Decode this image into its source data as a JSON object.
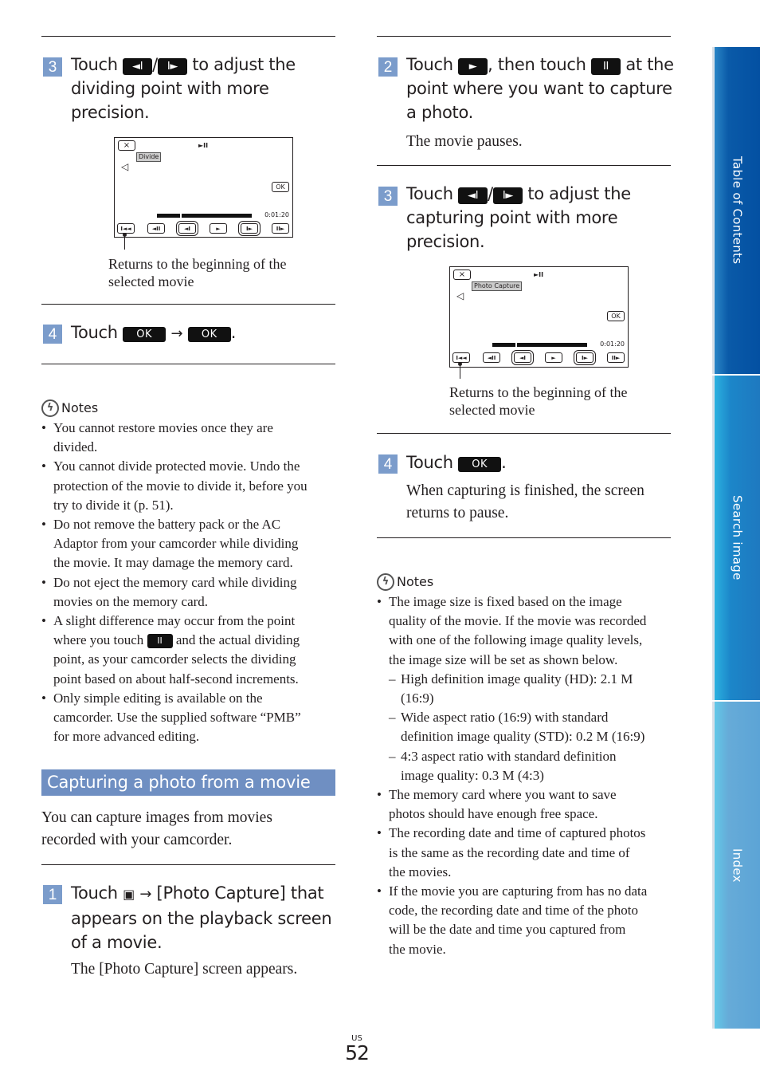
{
  "left": {
    "step3": {
      "number": "3",
      "pre": "Touch ",
      "icon1": "◄I",
      "sep": "/",
      "icon2": "I►",
      "post": " to adjust the",
      "line2": "dividing point with more",
      "line3": "precision."
    },
    "lcd": {
      "close": "×",
      "play_pause": "►II",
      "label": "Divide",
      "speaker": "🔈",
      "ok": "OK",
      "time": "0:01:20",
      "controls": [
        "I◄◄",
        "◄II",
        "◄I",
        "►",
        "I►",
        "II►"
      ],
      "progress_fraction": 0.24
    },
    "caption": [
      "Returns to the beginning of the",
      "selected movie"
    ],
    "step4": {
      "number": "4",
      "pre": "Touch ",
      "ok1": "OK",
      "arrow": "→",
      "ok2": "OK",
      "post": "."
    },
    "notes": {
      "title": "Notes",
      "items": [
        [
          "You cannot restore movies once they are",
          "divided."
        ],
        [
          "You cannot divide protected movie. Undo the",
          "protection of the movie to divide it, before you",
          "try to divide it (p. 51)."
        ],
        [
          "Do not remove the battery pack or the AC",
          "Adaptor from your camcorder while dividing",
          "the movie. It may damage the memory card."
        ],
        [
          "Do not eject the memory card while dividing",
          "movies on the memory card."
        ],
        [
          "A slight difference may occur from the point",
          "where you touch",
          "and the actual dividing",
          "point, as your camcorder selects the dividing",
          "point based on about half-second increments."
        ],
        [
          "Only simple editing is available on the",
          "camcorder. Use the supplied software “PMB”",
          "for more advanced editing."
        ]
      ],
      "pause_icon": "II"
    },
    "section_title": "Capturing a photo from a movie",
    "intro": [
      "You can capture images from movies",
      "recorded with your camcorder."
    ],
    "step1": {
      "number": "1",
      "pre": "Touch ",
      "icon": "▣",
      "arrow": "→",
      "post": " [Photo Capture] that",
      "line2": "appears on the playback screen",
      "line3": "of a movie.",
      "sub": "The [Photo Capture] screen appears."
    }
  },
  "right": {
    "step2": {
      "number": "2",
      "pre": "Touch ",
      "icon1": "►",
      "mid": ", then touch ",
      "icon2": "II",
      "post": " at the",
      "line2": "point where you want to capture",
      "line3": "a photo.",
      "sub": "The movie pauses."
    },
    "step3": {
      "number": "3",
      "pre": "Touch ",
      "icon1": "◄I",
      "sep": "/",
      "icon2": "I►",
      "post": " to adjust the",
      "line2": "capturing point with more",
      "line3": "precision."
    },
    "lcd": {
      "close": "×",
      "play_pause": "►II",
      "label": "Photo Capture",
      "speaker": "🔈",
      "ok": "OK",
      "time": "0:01:20",
      "controls": [
        "I◄◄",
        "◄II",
        "◄I",
        "►",
        "I►",
        "II►"
      ],
      "progress_fraction": 0.24
    },
    "caption": [
      "Returns to the beginning of the",
      "selected movie"
    ],
    "step4": {
      "number": "4",
      "pre": "Touch ",
      "ok": "OK",
      "post": ".",
      "sub1": "When capturing is finished, the screen",
      "sub2": "returns to pause."
    },
    "notes": {
      "title": "Notes",
      "lines": [
        {
          "t": "The image size is fixed based on the image",
          "k": "b"
        },
        {
          "t": "quality of the movie. If the movie was recorded",
          "k": "c"
        },
        {
          "t": "with one of the following image quality levels,",
          "k": "c"
        },
        {
          "t": "the image size will be set as shown below.",
          "k": "c"
        },
        {
          "t": "High definition image quality (HD): 2.1 M",
          "k": "s"
        },
        {
          "t": "(16:9)",
          "k": "sc"
        },
        {
          "t": "Wide aspect ratio (16:9) with standard",
          "k": "s"
        },
        {
          "t": "definition image quality (STD): 0.2 M (16:9)",
          "k": "sc"
        },
        {
          "t": "4:3 aspect ratio with standard definition",
          "k": "s"
        },
        {
          "t": "image quality: 0.3 M (4:3)",
          "k": "sc"
        },
        {
          "t": "The memory card where you want to save",
          "k": "b"
        },
        {
          "t": "photos should have enough free space.",
          "k": "c"
        },
        {
          "t": "The recording date and time of captured photos",
          "k": "b"
        },
        {
          "t": "is the same as the recording date and time of",
          "k": "c"
        },
        {
          "t": "the movies.",
          "k": "c"
        },
        {
          "t": "If the movie you are capturing from has no data",
          "k": "b"
        },
        {
          "t": "code, the recording date and time of the photo",
          "k": "c"
        },
        {
          "t": "will be the date and time you captured from",
          "k": "c"
        },
        {
          "t": "the movie.",
          "k": "c"
        }
      ]
    }
  },
  "sidebar": {
    "tabs": [
      {
        "label": "Table of Contents"
      },
      {
        "label": "Search image"
      },
      {
        "label": "Index"
      }
    ]
  },
  "footer": {
    "region": "US",
    "page": "52"
  }
}
